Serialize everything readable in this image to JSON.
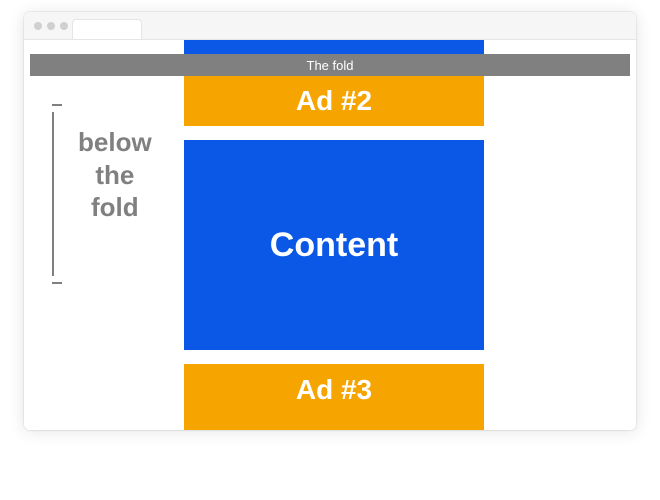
{
  "fold": {
    "label": "The fold"
  },
  "below_label": {
    "line1": "below",
    "line2": "the",
    "line3": "fold"
  },
  "blocks": {
    "ad2": "Ad #2",
    "content": "Content",
    "ad3": "Ad #3"
  },
  "colors": {
    "ad": "#f5a400",
    "content": "#0b57e6",
    "chrome_gray": "#808080"
  }
}
